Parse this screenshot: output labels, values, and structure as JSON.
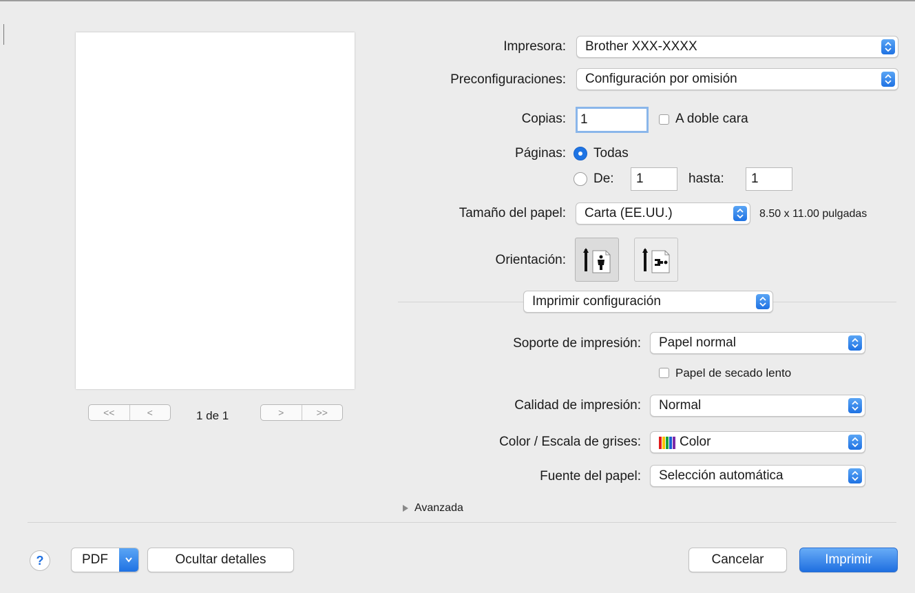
{
  "printer": {
    "label": "Impresora:",
    "value": "Brother XXX-XXXX"
  },
  "presets": {
    "label": "Preconfiguraciones:",
    "value": "Configuración por omisión"
  },
  "copies": {
    "label": "Copias:",
    "value": "1",
    "duplex_label": "A doble cara",
    "duplex_checked": false
  },
  "pages": {
    "label": "Páginas:",
    "all_label": "Todas",
    "range_label": "De:",
    "from_value": "1",
    "to_label": "hasta:",
    "to_value": "1",
    "selected": "all"
  },
  "paper_size": {
    "label": "Tamaño del papel:",
    "value": "Carta (EE.UU.)",
    "dimensions": "8.50 x 11.00 pulgadas"
  },
  "orientation": {
    "label": "Orientación:",
    "selected": "portrait"
  },
  "section": {
    "value": "Imprimir configuración"
  },
  "media_type": {
    "label": "Soporte de impresión:",
    "value": "Papel normal",
    "slow_dry_label": "Papel de secado lento",
    "slow_dry_checked": false
  },
  "quality": {
    "label": "Calidad de impresión:",
    "value": "Normal"
  },
  "color": {
    "label": "Color / Escala de grises:",
    "value": "Color"
  },
  "paper_source": {
    "label": "Fuente del papel:",
    "value": "Selección automática"
  },
  "advanced": {
    "label": "Avanzada"
  },
  "preview": {
    "page_indicator": "1 de 1",
    "first_glyph": "<<",
    "prev_glyph": "<",
    "next_glyph": ">",
    "last_glyph": ">>"
  },
  "footer": {
    "help_label": "?",
    "pdf_label": "PDF",
    "hide_details_label": "Ocultar detalles",
    "cancel_label": "Cancelar",
    "print_label": "Imprimir"
  },
  "colors": {
    "accent": "#1f72e3",
    "background": "#ececec"
  }
}
